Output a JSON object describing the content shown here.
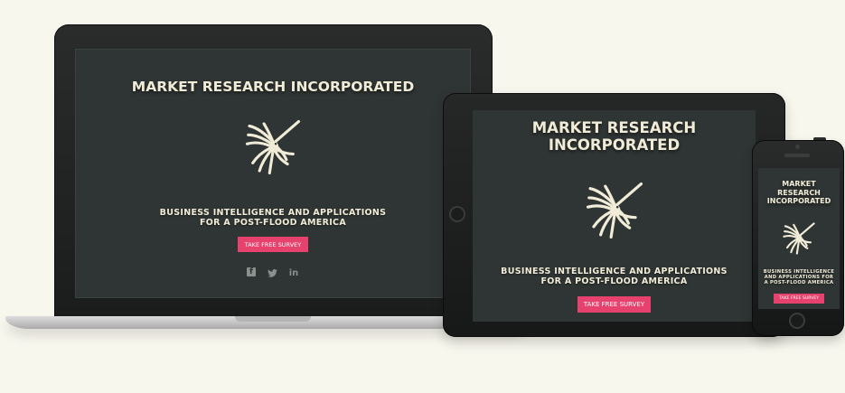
{
  "site": {
    "title": "MARKET RESEARCH INCORPORATED",
    "title_line1": "MARKET RESEARCH",
    "title_line2": "INCORPORATED",
    "phone_title_line1": "MARKET",
    "phone_title_line2": "RESEARCH",
    "phone_title_line3": "INCORPORATED",
    "logo_icon": "nazca-hummingbird-icon",
    "tagline_line1": "BUSINESS INTELLIGENCE AND APPLICATIONS",
    "tagline_line2": "FOR A POST-FLOOD AMERICA",
    "phone_tagline_line1": "BUSINESS INTELLIGENCE",
    "phone_tagline_line2": "AND APPLICATIONS FOR",
    "phone_tagline_line3": "A POST-FLOOD AMERICA",
    "cta_label": "TAKE FREE SURVEY",
    "social": [
      {
        "name": "facebook-icon",
        "glyph": "f"
      },
      {
        "name": "twitter-icon",
        "glyph": "🐦"
      },
      {
        "name": "linkedin-icon",
        "glyph": "in"
      }
    ]
  },
  "colors": {
    "page_background": "#f8f7ee",
    "screen_background": "#2f3534",
    "text_cream": "#f1ecd7",
    "cta_pink": "#e6426d",
    "social_gray": "#8a908d",
    "device_black": "#1b1c1c"
  }
}
